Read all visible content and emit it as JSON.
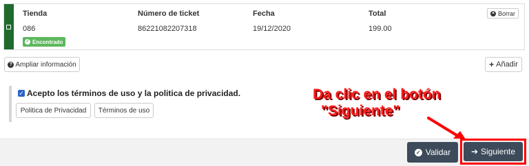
{
  "ticket": {
    "headers": {
      "tienda": "Tienda",
      "numero": "Número de ticket",
      "fecha": "Fecha",
      "total": "Total"
    },
    "row": {
      "tienda": "086",
      "numero": "86221082207318",
      "fecha": "19/12/2020",
      "total": "199.00"
    },
    "status_badge": "Encontrado",
    "delete_label": "Borrar"
  },
  "actions": {
    "ampliar_label": "Ampliar información",
    "anadir_label": "Añadir"
  },
  "terms": {
    "text": "Acepto los términos de uso y la politica de privacidad.",
    "checked": true,
    "privacy_button": "Politica de Privacidad",
    "terms_button": "Términos de uso"
  },
  "annotation": {
    "line1": "Da clic en el botón",
    "line2": "\"Siguiente\""
  },
  "footer": {
    "validar_label": "Validar",
    "siguiente_label": "Siguiente"
  },
  "colors": {
    "stripe": "#1f6b2d",
    "badge": "#5cb85c",
    "primary_button": "#3c4a5a",
    "annotation": "#ff1a1a"
  }
}
